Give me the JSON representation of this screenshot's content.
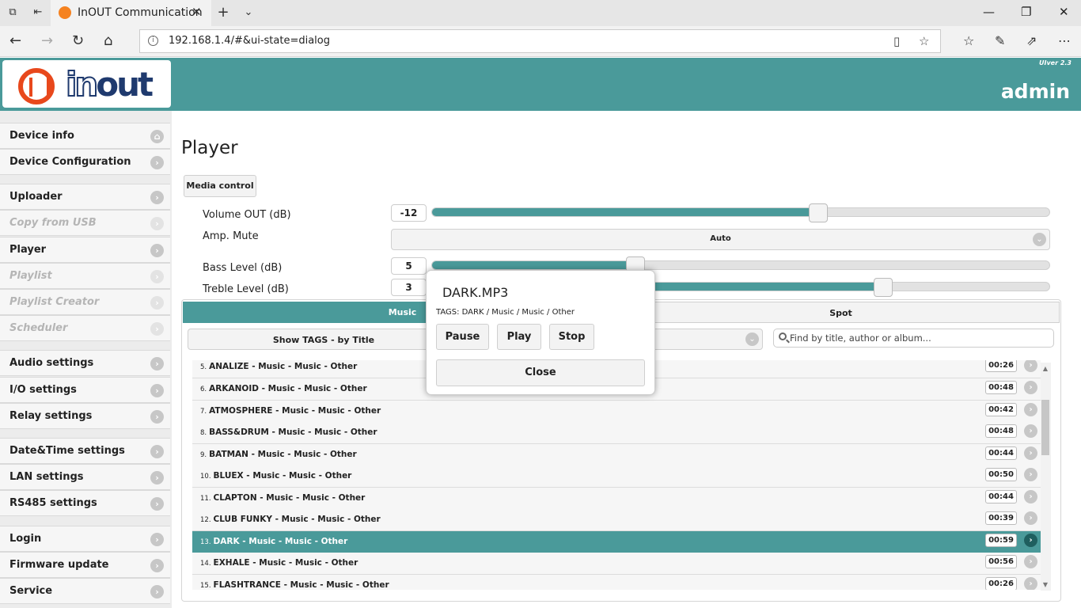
{
  "browser": {
    "tab_title": "InOUT Communication",
    "url": "192.168.1.4/#&ui-state=dialog"
  },
  "header": {
    "logo_in": "in",
    "logo_out": "out",
    "ui_version": "UIver 2.3",
    "user": "admin"
  },
  "sidebar": {
    "items": [
      {
        "label": "Device info"
      },
      {
        "label": "Device Configuration"
      },
      {
        "label": "Uploader"
      },
      {
        "label": "Copy from USB"
      },
      {
        "label": "Player"
      },
      {
        "label": "Playlist"
      },
      {
        "label": "Playlist Creator"
      },
      {
        "label": "Scheduler"
      },
      {
        "label": "Audio settings"
      },
      {
        "label": "I/O settings"
      },
      {
        "label": "Relay settings"
      },
      {
        "label": "Date&Time settings"
      },
      {
        "label": "LAN settings"
      },
      {
        "label": "RS485 settings"
      },
      {
        "label": "Login"
      },
      {
        "label": "Firmware update"
      },
      {
        "label": "Service"
      }
    ]
  },
  "main": {
    "title": "Player",
    "media_control_label": "Media control",
    "volume": {
      "label": "Volume OUT (dB)",
      "value": "-12",
      "level": 0.625
    },
    "amp_mute": {
      "label": "Amp. Mute",
      "value": "Auto"
    },
    "bass": {
      "label": "Bass Level (dB)",
      "value": "5",
      "level": 0.33
    },
    "treble": {
      "label": "Treble Level (dB)",
      "value": "3",
      "level": 0.73
    },
    "tabs": [
      {
        "label": "Music"
      },
      {
        "label": "Spot"
      }
    ],
    "tags_select": "Show TAGS - by Title",
    "search_placeholder": "Find by title, author or album..."
  },
  "tracks": [
    {
      "num": "5.",
      "title": "ANALIZE - Music - Music - Other",
      "duration": "00:26"
    },
    {
      "num": "6.",
      "title": "ARKANOID - Music - Music - Other",
      "duration": "00:48"
    },
    {
      "num": "7.",
      "title": "ATMOSPHERE - Music - Music - Other",
      "duration": "00:42"
    },
    {
      "num": "8.",
      "title": "BASS&DRUM - Music - Music - Other",
      "duration": "00:48"
    },
    {
      "num": "9.",
      "title": "BATMAN - Music - Music - Other",
      "duration": "00:44"
    },
    {
      "num": "10.",
      "title": "BLUEX - Music - Music - Other",
      "duration": "00:50"
    },
    {
      "num": "11.",
      "title": "CLAPTON - Music - Music - Other",
      "duration": "00:44"
    },
    {
      "num": "12.",
      "title": "CLUB FUNKY - Music - Music - Other",
      "duration": "00:39"
    },
    {
      "num": "13.",
      "title": "DARK - Music - Music - Other",
      "duration": "00:59"
    },
    {
      "num": "14.",
      "title": "EXHALE - Music - Music - Other",
      "duration": "00:56"
    },
    {
      "num": "15.",
      "title": "FLASHTRANCE - Music - Music - Other",
      "duration": "00:26"
    }
  ],
  "dialog": {
    "title": "DARK.MP3",
    "tags": "TAGS: DARK / Music / Music / Other",
    "pause_label": "Pause",
    "play_label": "Play",
    "stop_label": "Stop",
    "close_label": "Close"
  },
  "colors": {
    "accent": "#4a9a9a",
    "logo_orange": "#e8481c",
    "logo_navy": "#1f3a6e"
  }
}
